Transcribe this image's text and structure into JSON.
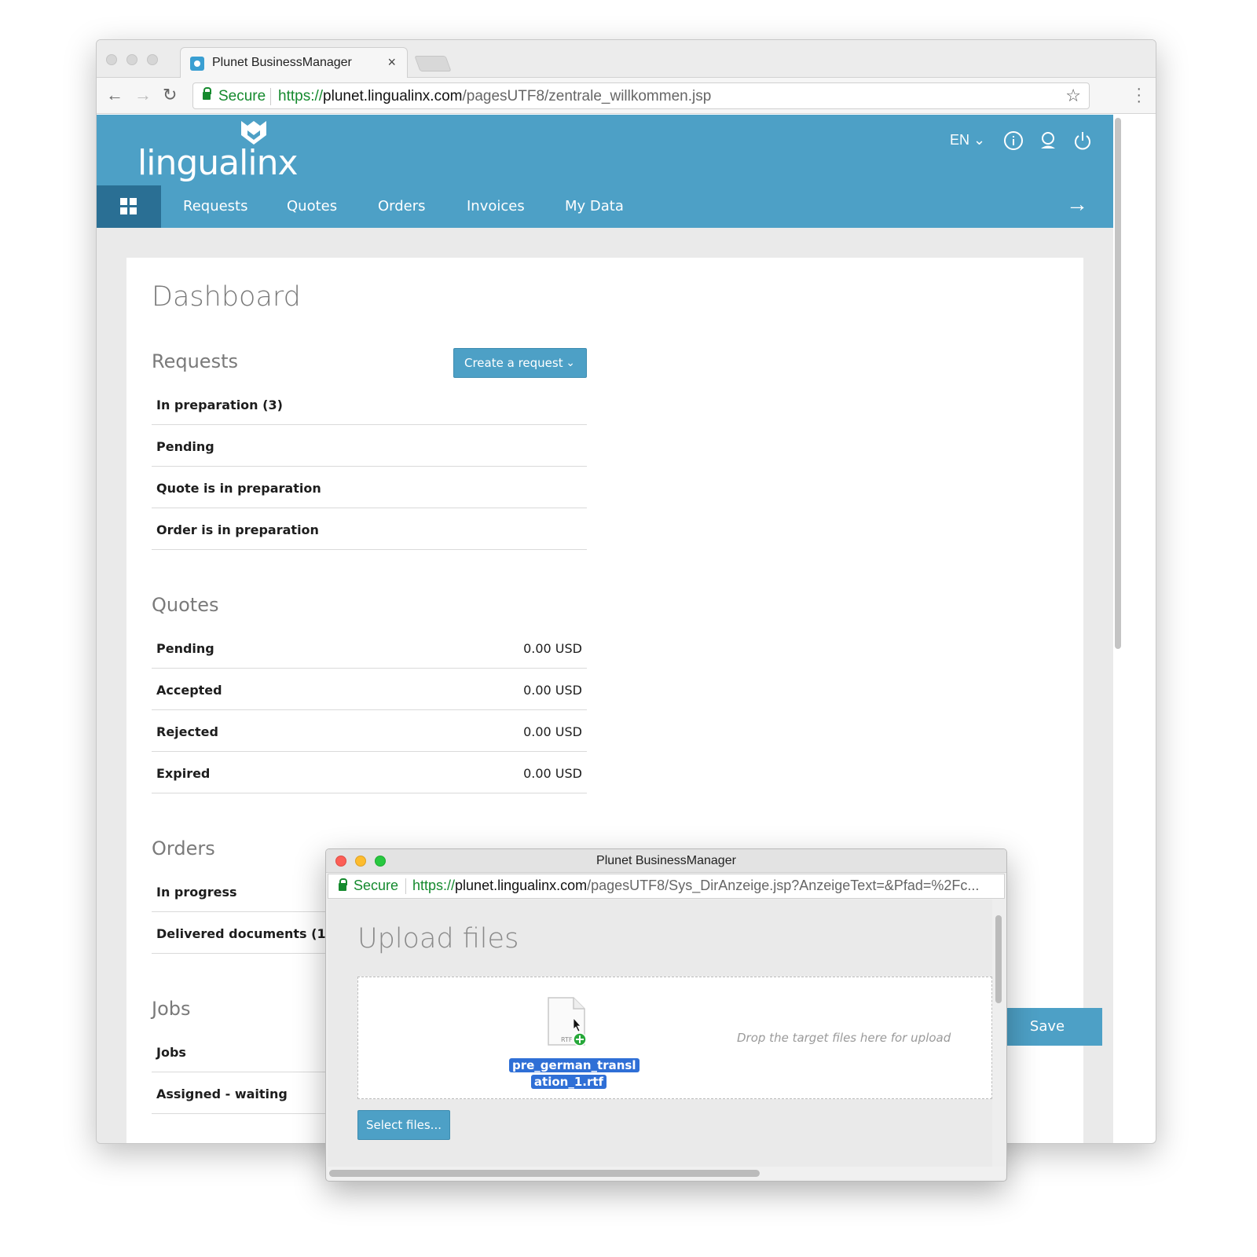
{
  "browser": {
    "tab_title": "Plunet BusinessManager",
    "tab_close": "×",
    "secure_label": "Secure",
    "url_scheme": "https://",
    "url_host": "plunet.lingualinx.com",
    "url_path": "/pagesUTF8/zentrale_willkommen.jsp"
  },
  "header": {
    "logo_text": "lingualinx",
    "language": "EN",
    "brand_color": "#4da0c6"
  },
  "nav": {
    "items": [
      "Requests",
      "Quotes",
      "Orders",
      "Invoices",
      "My Data"
    ]
  },
  "dashboard": {
    "title": "Dashboard",
    "requests": {
      "title": "Requests",
      "create_button": "Create a request",
      "rows": [
        "In preparation (3)",
        "Pending",
        "Quote is in preparation",
        "Order is in preparation"
      ]
    },
    "quotes": {
      "title": "Quotes",
      "rows": [
        {
          "label": "Pending",
          "amount": "0.00 USD"
        },
        {
          "label": "Accepted",
          "amount": "0.00 USD"
        },
        {
          "label": "Rejected",
          "amount": "0.00 USD"
        },
        {
          "label": "Expired",
          "amount": "0.00 USD"
        }
      ]
    },
    "orders": {
      "title": "Orders",
      "rows": [
        "In progress",
        "Delivered documents (1)"
      ]
    },
    "jobs": {
      "title": "Jobs",
      "rows": [
        "Jobs",
        "Assigned - waiting"
      ]
    },
    "save_button": "Save"
  },
  "popup": {
    "window_title": "Plunet BusinessManager",
    "secure_label": "Secure",
    "url_scheme": "https://",
    "url_host": "plunet.lingualinx.com",
    "url_path": "/pagesUTF8/Sys_DirAnzeige.jsp?AnzeigeText=&Pfad=%2Fc...",
    "heading": "Upload files",
    "drop_hint": "Drop the target files here for upload",
    "file_type": "RTF",
    "file_name_line1": "pre_german_transl",
    "file_name_line2": "ation_1.rtf",
    "select_button": "Select files..."
  }
}
